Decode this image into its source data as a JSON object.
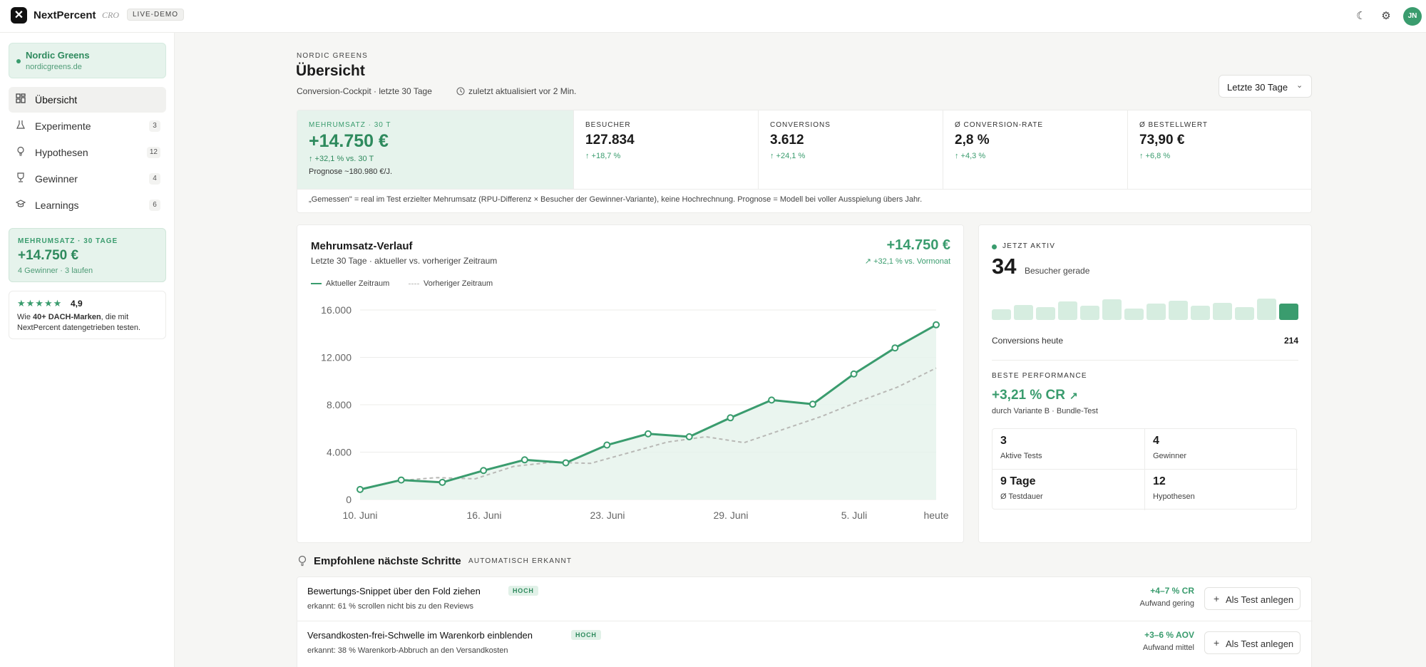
{
  "app": {
    "brand": "NextPercent",
    "brand_sub": "CRO",
    "demo_badge": "LIVE-DEMO",
    "avatar": "JN",
    "icons": [
      "moon-icon",
      "gear-icon"
    ]
  },
  "workspace": {
    "name": "Nordic Greens",
    "url": "nordicgreens.de"
  },
  "nav": [
    {
      "label": "Übersicht",
      "count": "",
      "icon": "grid-icon",
      "active": true
    },
    {
      "label": "Experimente",
      "count": "3",
      "icon": "flask-icon"
    },
    {
      "label": "Hypothesen",
      "count": "12",
      "icon": "bulb-icon"
    },
    {
      "label": "Gewinner",
      "count": "4",
      "icon": "trophy-icon"
    },
    {
      "label": "Learnings",
      "count": "6",
      "icon": "cap-icon"
    }
  ],
  "side_stat": {
    "label": "MEHRUMSATZ · 30 TAGE",
    "value": "+14.750 €",
    "sub": "4 Gewinner · 3 laufen"
  },
  "review": {
    "stars": "★★★★★",
    "rating": "4,9",
    "text_prefix": "Wie ",
    "text_bold": "40+ DACH-Marken",
    "text_suffix": ", die mit NextPercent datengetrieben testen."
  },
  "header": {
    "eyebrow": "NORDIC GREENS",
    "title": "Übersicht",
    "subtitle": "Conversion-Cockpit · letzte 30 Tage",
    "updated": "zuletzt aktualisiert vor 2 Min.",
    "range": "Letzte 30 Tage"
  },
  "kpis": [
    {
      "label": "MEHRUMSATZ · 30 T",
      "value": "+14.750 €",
      "delta": "↑ +32,1 % vs. 30 T",
      "prognosis": "Prognose ~180.980 €/J."
    },
    {
      "label": "BESUCHER",
      "value": "127.834",
      "delta": "↑ +18,7 %"
    },
    {
      "label": "CONVERSIONS",
      "value": "3.612",
      "delta": "↑ +24,1 %"
    },
    {
      "label": "Ø CONVERSION-RATE",
      "value": "2,8 %",
      "delta": "↑ +4,3 %"
    },
    {
      "label": "Ø BESTELLWERT",
      "value": "73,90 €",
      "delta": "↑ +6,8 %"
    }
  ],
  "kpi_note": "„Gemessen\" = real im Test erzielter Mehrumsatz (RPU-Differenz × Besucher der Gewinner-Variante), keine Hochrechnung. Prognose = Modell bei voller Ausspielung übers Jahr.",
  "chart_card": {
    "title": "Mehrumsatz-Verlauf",
    "subtitle": "Letzte 30 Tage · aktueller vs. vorheriger Zeitraum",
    "total": "+14.750 €",
    "delta": "+32,1 % vs. Vormonat"
  },
  "chart_data": {
    "type": "area",
    "x_tick_labels": [
      "10. Juni",
      "16. Juni",
      "23. Juni",
      "29. Juni",
      "5. Juli",
      "heute"
    ],
    "y_ticks": [
      0,
      4000,
      8000,
      12000,
      16000
    ],
    "y_tick_labels": [
      "0",
      "4.000",
      "8.000",
      "12.000",
      "16.000"
    ],
    "ylim": [
      0,
      16000
    ],
    "grid": true,
    "legend": "top-left",
    "series": [
      {
        "name": "Aktueller Zeitraum",
        "color": "#3a9c6e",
        "style": "solid",
        "markers": true,
        "values": [
          850,
          1650,
          1450,
          2450,
          3350,
          3100,
          4600,
          5550,
          5300,
          6900,
          8400,
          8050,
          10600,
          12800,
          14750
        ]
      },
      {
        "name": "Vorheriger Zeitraum",
        "color": "#b9b9b6",
        "style": "dashed",
        "markers": false,
        "values": [
          850,
          1600,
          1850,
          1750,
          2800,
          3150,
          3050,
          3950,
          4850,
          5300,
          4800,
          5900,
          7000,
          8300,
          9500,
          11100
        ]
      }
    ]
  },
  "live": {
    "label": "JETZT AKTIV",
    "count": "34",
    "unit": "Besucher gerade",
    "bars": [
      0.45,
      0.62,
      0.53,
      0.75,
      0.58,
      0.85,
      0.48,
      0.68,
      0.78,
      0.58,
      0.71,
      0.52,
      0.88,
      0.67
    ]
  },
  "conversions_today": {
    "label": "Conversions heute",
    "value": "214"
  },
  "best": {
    "label": "BESTE PERFORMANCE",
    "value": "+3,21 % CR",
    "sub": "durch Variante B · Bundle-Test"
  },
  "stats": [
    {
      "value": "3",
      "label": "Aktive Tests"
    },
    {
      "value": "4",
      "label": "Gewinner"
    },
    {
      "value": "9 Tage",
      "label": "Ø Testdauer"
    },
    {
      "value": "12",
      "label": "Hypothesen"
    }
  ],
  "next": {
    "title": "Empfohlene nächste Schritte",
    "badge": "AUTOMATISCH ERKANNT"
  },
  "recommendations": [
    {
      "title": "Bewertungs-Snippet über den Fold ziehen",
      "tag": "HOCH",
      "sub": "erkannt: 61 % scrollen nicht bis zu den Reviews",
      "impact": "+4–7 % CR",
      "effort": "Aufwand gering",
      "button": "Als Test anlegen"
    },
    {
      "title": "Versandkosten-frei-Schwelle im Warenkorb einblenden",
      "tag": "HOCH",
      "sub": "erkannt: 38 % Warenkorb-Abbruch an den Versandkosten",
      "impact": "+3–6 % AOV",
      "effort": "Aufwand mittel",
      "button": "Als Test anlegen"
    }
  ]
}
